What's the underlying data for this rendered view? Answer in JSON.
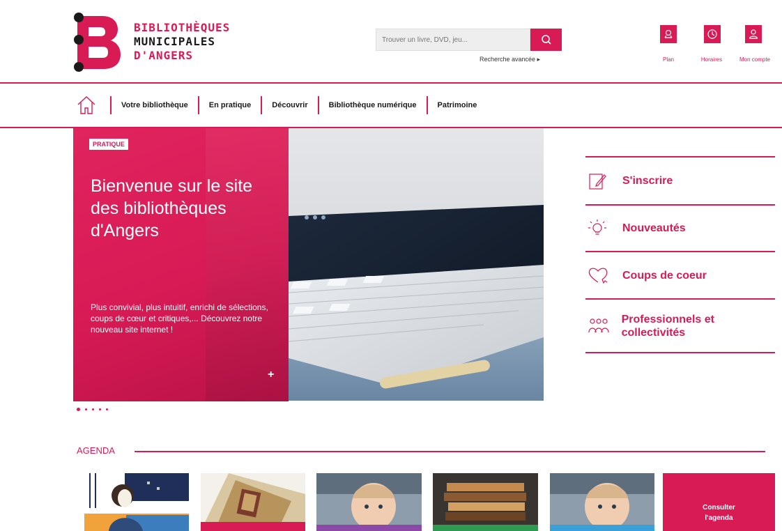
{
  "logo": {
    "line1": "BIBLIOTHÈQUES",
    "line2": "MUNICIPALES",
    "line3": "D'ANGERS"
  },
  "search": {
    "placeholder": "Trouver un livre, DVD, jeu...",
    "advanced": "Recherche avancée ▸"
  },
  "top_icons": [
    {
      "label": "Plan",
      "icon": "map-pin-icon"
    },
    {
      "label": "Horaires",
      "icon": "clock-icon"
    },
    {
      "label": "Mon compte",
      "icon": "user-icon"
    }
  ],
  "nav": {
    "items": [
      "Votre bibliothèque",
      "En pratique",
      "Découvrir",
      "Bibliothèque numérique",
      "Patrimoine"
    ]
  },
  "hero": {
    "badge": "PRATIQUE",
    "title": "Bienvenue sur le site des bibliothèques d'Angers",
    "description": "Plus convivial, plus intuitif, enrichi de sélections, coups de cœur et critiques,... Découvrez notre nouveau site internet !",
    "plus": "+",
    "slides": 5,
    "active_slide": 1
  },
  "side_menu": {
    "items": [
      {
        "label": "S'inscrire",
        "icon": "edit-note-icon"
      },
      {
        "label": "Nouveautés",
        "icon": "lightbulb-icon"
      },
      {
        "label": "Coups de coeur",
        "icon": "heart-icon"
      },
      {
        "label": "Professionnels et collectivités",
        "icon": "people-icon"
      }
    ]
  },
  "agenda": {
    "title": "AGENDA",
    "cta": "Consulter l'agenda"
  },
  "colors": {
    "brand": "#d81a55",
    "dark": "#1a1a1a"
  }
}
